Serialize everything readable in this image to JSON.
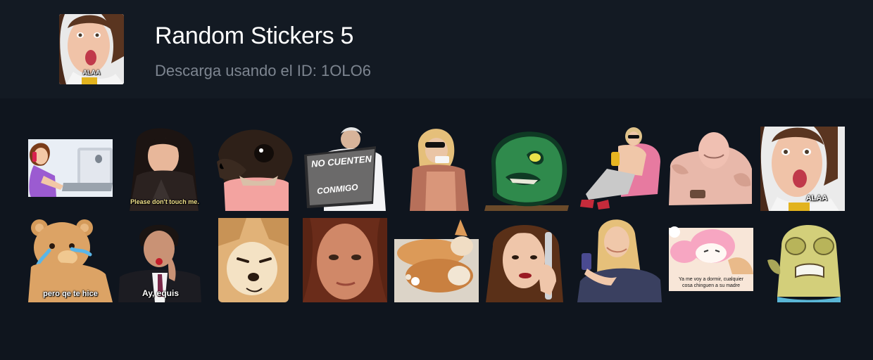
{
  "pack": {
    "title": "Random Stickers 5",
    "subtitle": "Descarga usando el ID: 1OLO6"
  },
  "header_thumb_caption": "ALAA",
  "stickers": [
    {
      "name": "sticker-girl-laptop-phone",
      "caption": ""
    },
    {
      "name": "sticker-please-dont-touch-me",
      "caption": "Please don't touch me."
    },
    {
      "name": "sticker-chihuahua-face",
      "caption": ""
    },
    {
      "name": "sticker-no-cuenten-conmigo",
      "caption_line1": "NO CUENTEN",
      "caption_line2": "CONMIGO"
    },
    {
      "name": "sticker-woman-sunglasses-cup",
      "caption": ""
    },
    {
      "name": "sticker-green-monster",
      "caption": ""
    },
    {
      "name": "sticker-girl-sunglasses-couch",
      "caption": ""
    },
    {
      "name": "sticker-pink-creature",
      "caption": ""
    },
    {
      "name": "sticker-girl-alaa",
      "caption": "ALAA"
    },
    {
      "name": "sticker-crying-teddy",
      "caption": "pero qe te hice"
    },
    {
      "name": "sticker-man-ay-equis",
      "caption": "Ay, equis"
    },
    {
      "name": "sticker-shiba-dog",
      "caption": ""
    },
    {
      "name": "sticker-girl-closeup",
      "caption": ""
    },
    {
      "name": "sticker-corgis",
      "caption": ""
    },
    {
      "name": "sticker-woman-phone-call",
      "caption": ""
    },
    {
      "name": "sticker-girl-cellphone",
      "caption": ""
    },
    {
      "name": "sticker-my-melody",
      "caption_line1": "Ya me voy a dormir, cualquier",
      "caption_line2": "cosa chinguen a su madre"
    },
    {
      "name": "sticker-yellow-fish",
      "caption": ""
    }
  ],
  "colors": {
    "background": "#0f151e",
    "header": "#131a23",
    "title": "#ffffff",
    "subtitle": "#7d8590"
  }
}
